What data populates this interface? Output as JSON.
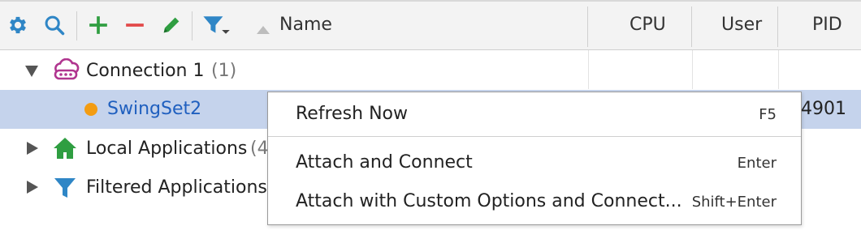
{
  "toolbar": {
    "icons": [
      "gear-icon",
      "search-icon",
      "plus-icon",
      "minus-icon",
      "pencil-icon",
      "filter-dropdown-icon"
    ],
    "colors": {
      "blue": "#2f86c6",
      "green": "#2f9e41",
      "red": "#e24848"
    }
  },
  "columns": {
    "name": "Name",
    "cpu": "CPU",
    "user": "User",
    "pid": "PID"
  },
  "tree": {
    "connection": {
      "label": "Connection 1",
      "count": "(1)"
    },
    "swingset": {
      "label": "SwingSet2",
      "pid_partial": "4901",
      "status_color": "#f39c12"
    },
    "local": {
      "label": "Local Applications",
      "count_partial": "(4"
    },
    "filtered": {
      "label": "Filtered Applications"
    }
  },
  "context_menu": {
    "items": [
      {
        "label": "Refresh Now",
        "shortcut": "F5"
      },
      {
        "label": "Attach and Connect",
        "shortcut": "Enter"
      },
      {
        "label": "Attach with Custom Options and Connect...",
        "shortcut": "Shift+Enter"
      }
    ]
  }
}
